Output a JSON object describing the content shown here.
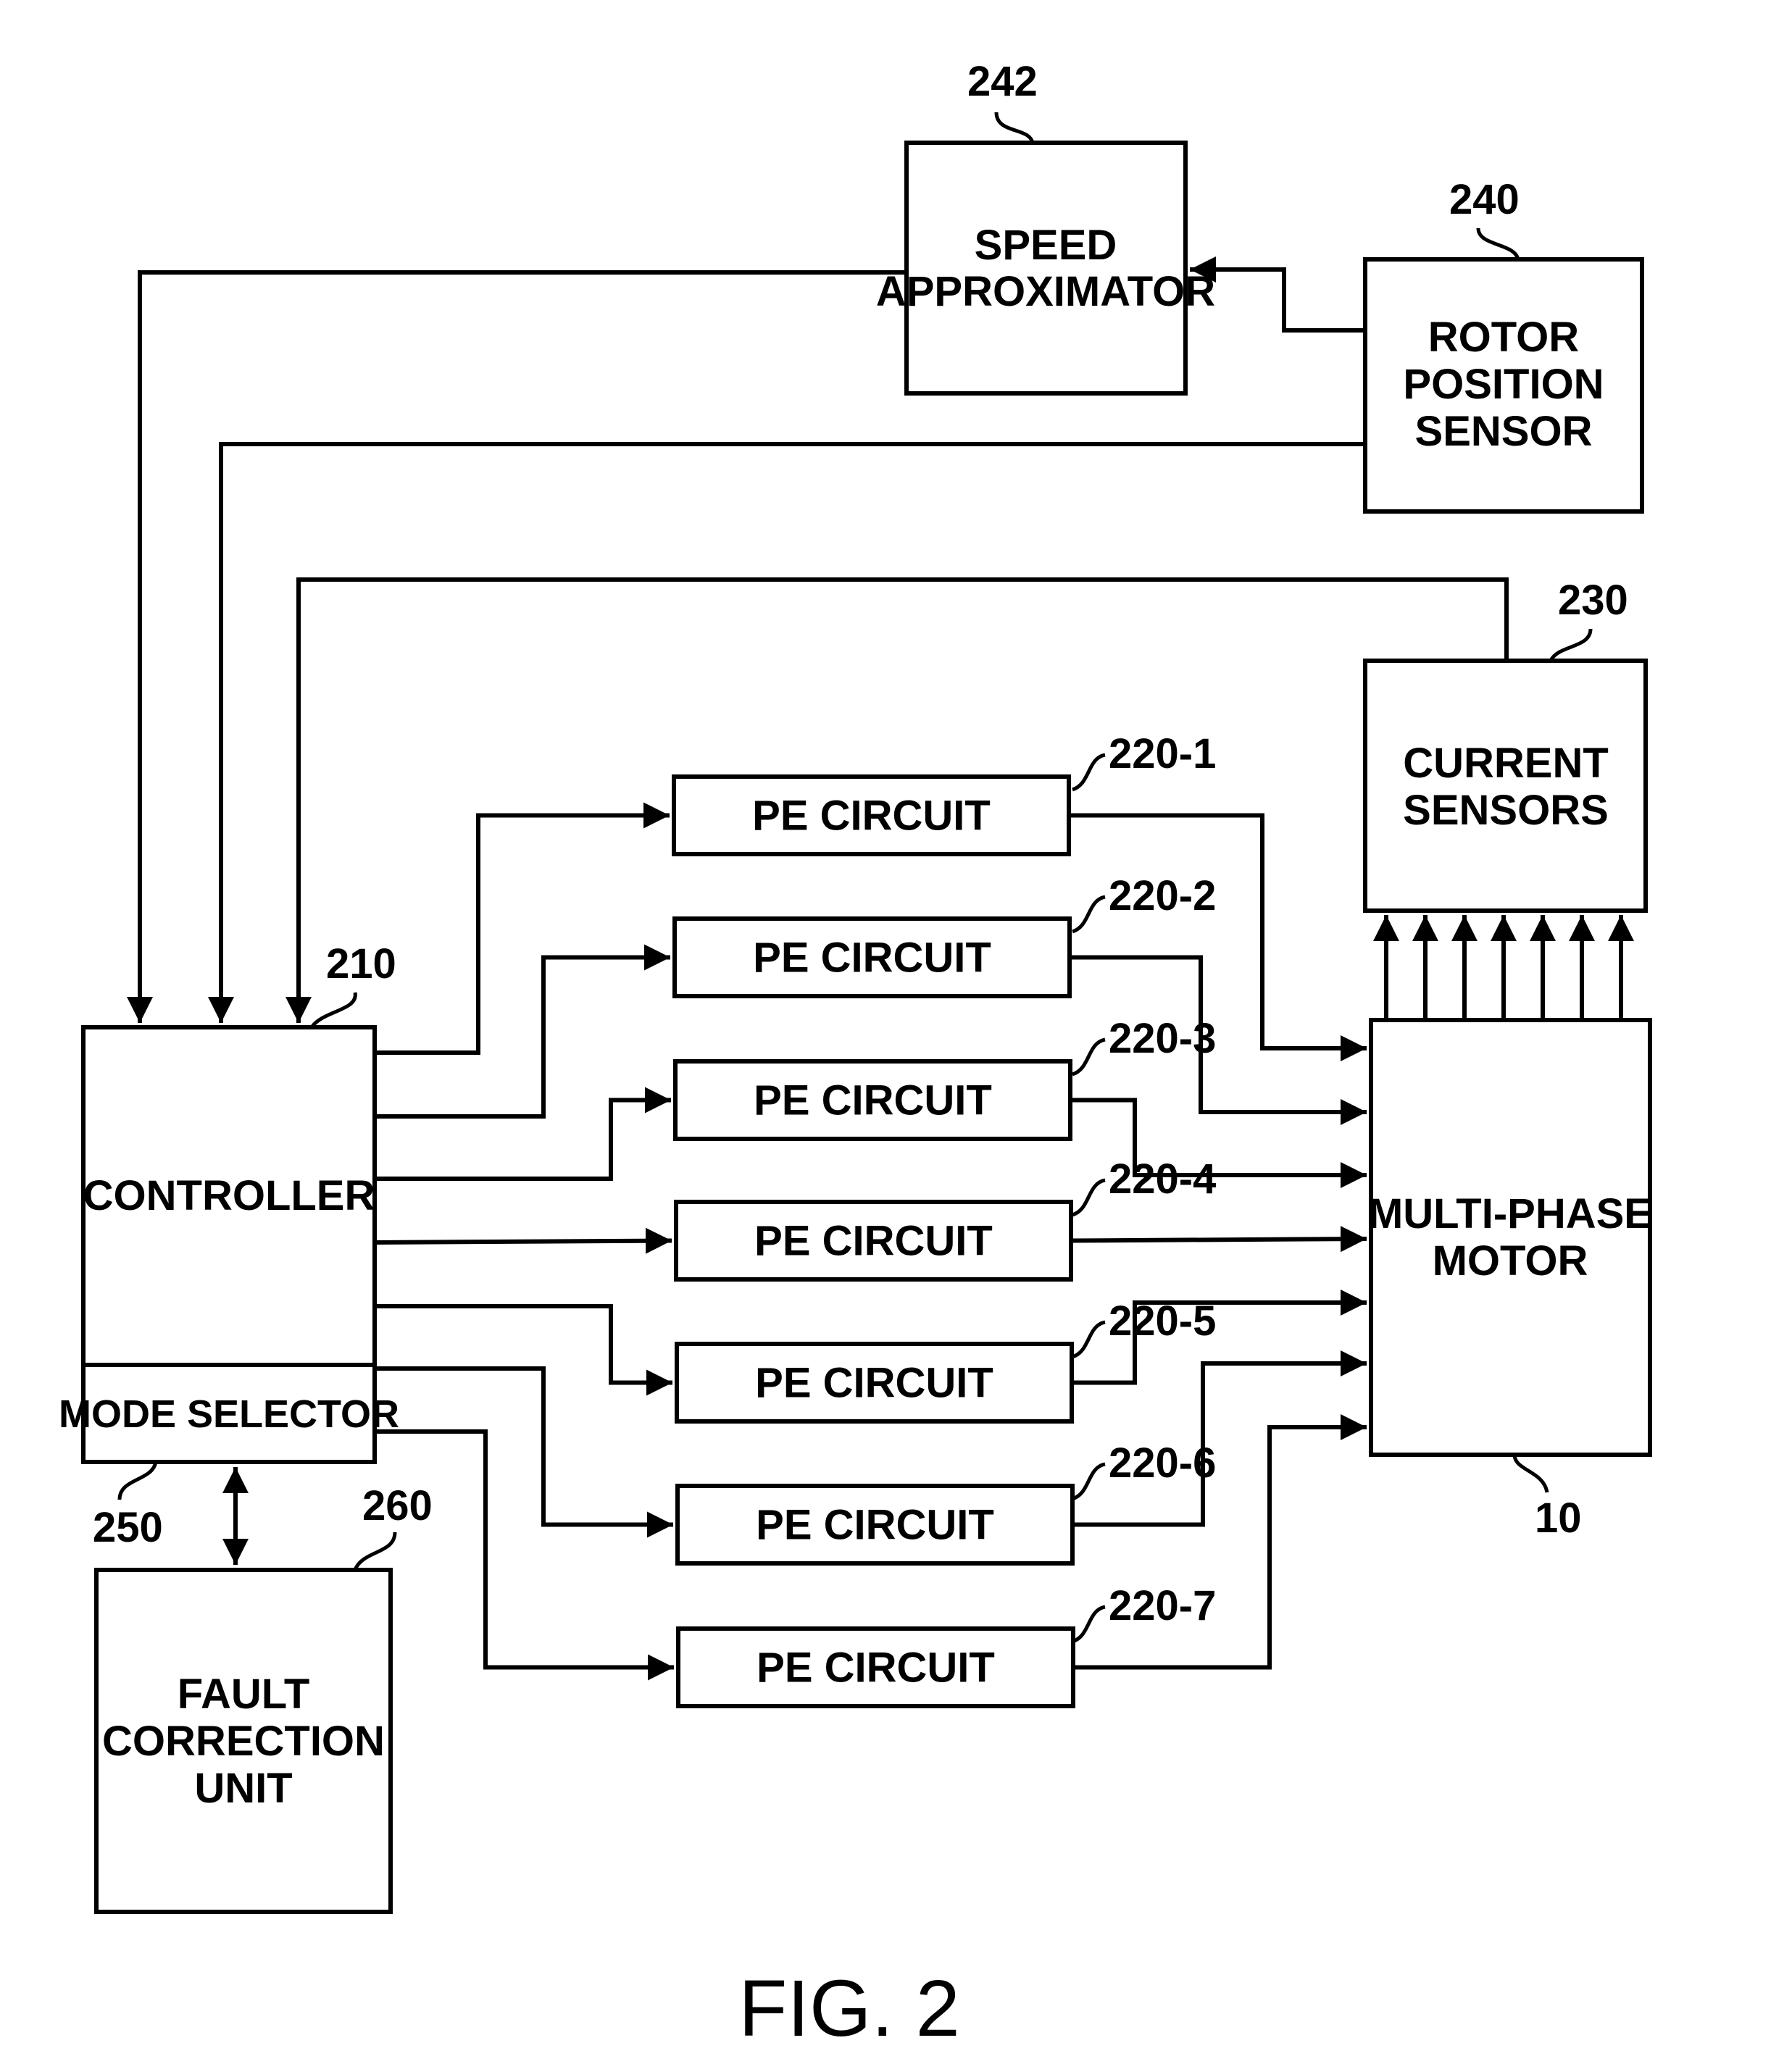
{
  "figure": {
    "caption": "FIG. 2"
  },
  "blocks": {
    "speed_approximator": {
      "ref": "242",
      "lines": [
        "SPEED",
        "APPROXIMATOR"
      ]
    },
    "rotor_position_sensor": {
      "ref": "240",
      "lines": [
        "ROTOR",
        "POSITION",
        "SENSOR"
      ]
    },
    "current_sensors": {
      "ref": "230",
      "lines": [
        "CURRENT",
        "SENSORS"
      ]
    },
    "controller": {
      "ref": "210",
      "lines": [
        "CONTROLLER"
      ]
    },
    "mode_selector": {
      "ref": "250",
      "lines": [
        "MODE SELECTOR"
      ]
    },
    "fault_correction_unit": {
      "ref": "260",
      "lines": [
        "FAULT",
        "CORRECTION",
        "UNIT"
      ]
    },
    "multi_phase_motor": {
      "ref": "10",
      "lines": [
        "MULTI-PHASE",
        "MOTOR"
      ]
    }
  },
  "pe_circuits": [
    {
      "label": "PE CIRCUIT",
      "ref": "220-1"
    },
    {
      "label": "PE CIRCUIT",
      "ref": "220-2"
    },
    {
      "label": "PE CIRCUIT",
      "ref": "220-3"
    },
    {
      "label": "PE CIRCUIT",
      "ref": "220-4"
    },
    {
      "label": "PE CIRCUIT",
      "ref": "220-5"
    },
    {
      "label": "PE CIRCUIT",
      "ref": "220-6"
    },
    {
      "label": "PE CIRCUIT",
      "ref": "220-7"
    }
  ],
  "colors": {
    "ink": "#000000",
    "paper": "#ffffff"
  }
}
